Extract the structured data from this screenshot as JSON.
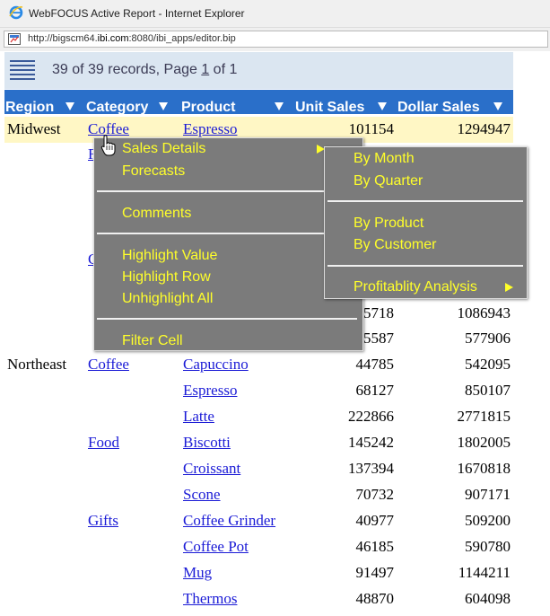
{
  "window": {
    "title": "WebFOCUS Active Report - Internet Explorer"
  },
  "address": {
    "prefix": "http://bigscm64.",
    "host": "ibi.com",
    "rest": ":8080/ibi_apps/editor.bip"
  },
  "records": {
    "count_text": "39 of 39 records, Page ",
    "page": "1",
    "suffix": " of 1"
  },
  "columns": [
    "Region",
    "Category",
    "Product",
    "Unit Sales",
    "Dollar Sales"
  ],
  "rows": [
    {
      "region": "Midwest",
      "category": "Coffee",
      "product": "Espresso",
      "unit_sales": "101154",
      "dollar_sales": "1294947",
      "highlighted": true
    },
    {
      "region": "",
      "category": "",
      "product": "",
      "unit_sales": "5718",
      "dollar_sales": "1086943"
    },
    {
      "region": "",
      "category": "",
      "product": "",
      "unit_sales": "5587",
      "dollar_sales": "577906"
    },
    {
      "region": "Northeast",
      "category": "Coffee",
      "product": "Capuccino",
      "unit_sales": "44785",
      "dollar_sales": "542095"
    },
    {
      "region": "",
      "category": "",
      "product": "Espresso",
      "unit_sales": "68127",
      "dollar_sales": "850107"
    },
    {
      "region": "",
      "category": "",
      "product": "Latte",
      "unit_sales": "222866",
      "dollar_sales": "2771815"
    },
    {
      "region": "",
      "category": "Food",
      "product": "Biscotti",
      "unit_sales": "145242",
      "dollar_sales": "1802005"
    },
    {
      "region": "",
      "category": "",
      "product": "Croissant",
      "unit_sales": "137394",
      "dollar_sales": "1670818"
    },
    {
      "region": "",
      "category": "",
      "product": "Scone",
      "unit_sales": "70732",
      "dollar_sales": "907171"
    },
    {
      "region": "",
      "category": "Gifts",
      "product": "Coffee Grinder",
      "unit_sales": "40977",
      "dollar_sales": "509200"
    },
    {
      "region": "",
      "category": "",
      "product": "Coffee Pot",
      "unit_sales": "46185",
      "dollar_sales": "590780"
    },
    {
      "region": "",
      "category": "",
      "product": "Mug",
      "unit_sales": "91497",
      "dollar_sales": "1144211"
    },
    {
      "region": "",
      "category": "",
      "product": "Thermos",
      "unit_sales": "48870",
      "dollar_sales": "604098"
    }
  ],
  "context_menu": {
    "items": [
      "Sales Details",
      "Forecasts",
      "Comments",
      "Highlight Value",
      "Highlight Row",
      "Unhighlight All",
      "Filter Cell"
    ]
  },
  "sub_menu": {
    "items": [
      "By Month",
      "By Quarter",
      "By Product",
      "By Customer",
      "Profitablity Analysis"
    ]
  },
  "colors": {
    "header_bg": "#2a6fc9",
    "record_bar_bg": "#dbe6f1",
    "menu_bg": "#7b7b7b",
    "menu_text": "#ffff2a",
    "highlight_row": "#fff7c5",
    "link": "#1b1bd6"
  }
}
